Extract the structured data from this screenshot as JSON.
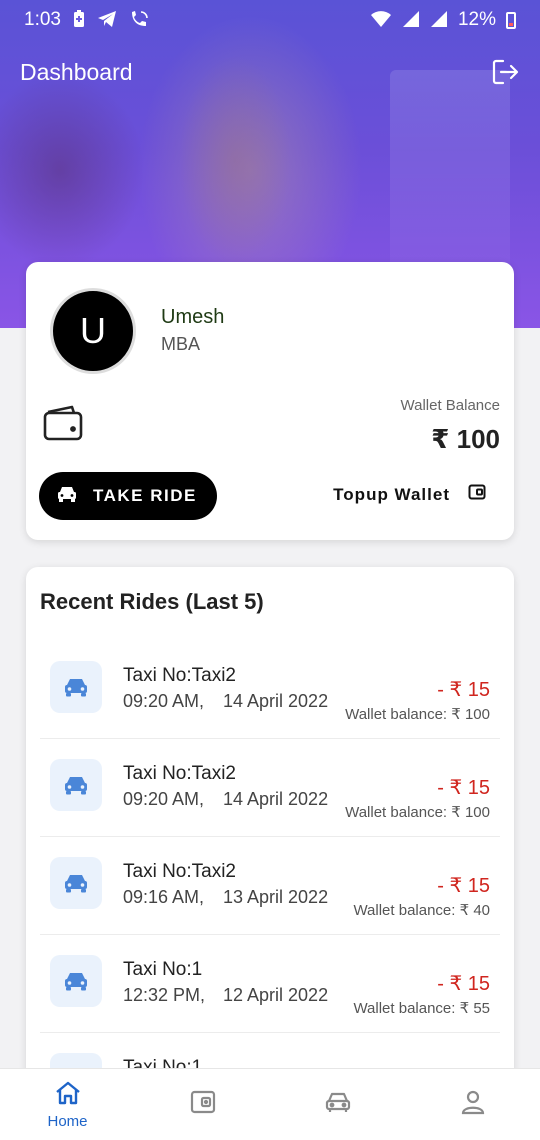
{
  "status_bar": {
    "time": "1:03",
    "battery_percent": "12%",
    "icons": [
      "battery-saver-icon",
      "telegram-icon",
      "wifi-call-icon",
      "wifi-icon",
      "signal-icon",
      "signal-icon",
      "battery-low-icon"
    ]
  },
  "app_bar": {
    "title": "Dashboard",
    "logout_icon": "logout-icon"
  },
  "profile": {
    "avatar_letter": "U",
    "name": "Umesh",
    "degree": "MBA",
    "wallet_icon": "wallet-icon",
    "wallet_label": "Wallet Balance",
    "wallet_value": "₹ 100",
    "take_ride_label": "TAKE RIDE",
    "topup_label": "Topup Wallet"
  },
  "recent_rides": {
    "title": "Recent Rides (Last 5)",
    "items": [
      {
        "taxi": "Taxi No:Taxi2",
        "time": "09:20 AM,",
        "date": "14 April 2022",
        "amount": "- ₹ 15",
        "balance": "Wallet balance: ₹ 100"
      },
      {
        "taxi": "Taxi No:Taxi2",
        "time": "09:20 AM,",
        "date": "14 April 2022",
        "amount": "- ₹ 15",
        "balance": "Wallet balance: ₹ 100"
      },
      {
        "taxi": "Taxi No:Taxi2",
        "time": "09:16 AM,",
        "date": "13 April 2022",
        "amount": "- ₹ 15",
        "balance": "Wallet balance: ₹ 40"
      },
      {
        "taxi": "Taxi No:1",
        "time": "12:32 PM,",
        "date": "12 April 2022",
        "amount": "- ₹ 15",
        "balance": "Wallet balance: ₹ 55"
      },
      {
        "taxi": "Taxi No:1",
        "time": "",
        "date": "",
        "amount": "",
        "balance": ""
      }
    ]
  },
  "bottom_nav": {
    "home_label": "Home",
    "items": [
      "home-icon",
      "wallet-icon",
      "car-icon",
      "profile-icon"
    ],
    "active_color": "#1e64c8"
  },
  "colors": {
    "hero_start": "#5a53d6",
    "hero_end": "#8a55e6",
    "debit": "#d0261f",
    "ride_icon": "#4a86d8"
  }
}
